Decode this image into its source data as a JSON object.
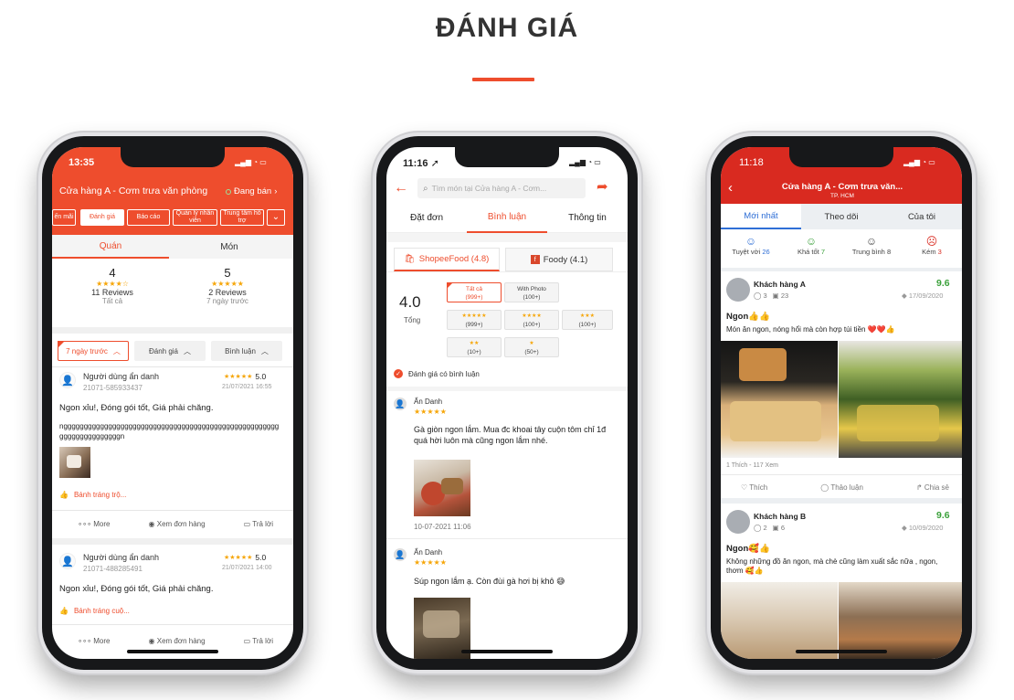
{
  "title": "ĐÁNH GIÁ",
  "colors": {
    "accent": "#ee4d2d",
    "star": "#f6a609",
    "green": "#3aa03a",
    "blue": "#2f6fd6"
  },
  "phone1": {
    "time": "13:35",
    "shop_name": "Cửa hàng A - Cơm trưa văn phòng",
    "status": "Đang bán",
    "chips": [
      "ến mãi",
      "Đánh giá",
      "Báo cáo",
      "Quản lý nhân viên",
      "Trung tâm hỗ trợ"
    ],
    "tabs": [
      "Quán",
      "Món"
    ],
    "summary": [
      {
        "score": "4",
        "reviews": "11 Reviews",
        "caption": "Tất cả"
      },
      {
        "score": "5",
        "reviews": "2 Reviews",
        "caption": "7 ngày trước"
      }
    ],
    "filters": [
      "7 ngày trước",
      "Đánh giá",
      "Bình luận"
    ],
    "reviews": [
      {
        "user": "Người dùng ẩn danh",
        "order_id": "21071-585933437",
        "score": "5.0",
        "date": "21/07/2021 16:55",
        "text": "Ngon xỉu!, Đóng gói tốt, Giá phải chăng.",
        "extra": "nggggggggggggggggggggggggggggggggggggggggggggggggggggggggggggggggggggn",
        "tag": "Bánh tráng trộ..."
      },
      {
        "user": "Người dùng ẩn danh",
        "order_id": "21071-488285491",
        "score": "5.0",
        "date": "21/07/2021 14:00",
        "text": "Ngon xỉu!, Đóng gói tốt, Giá phải chăng.",
        "tag": "Bánh tráng cuộ..."
      }
    ],
    "actions": [
      "More",
      "Xem đơn hàng",
      "Trả lời"
    ]
  },
  "phone2": {
    "time": "11:16",
    "search_placeholder": "Tìm món tại Cửa hàng A - Cơm...",
    "tabs": [
      "Đặt đơn",
      "Bình luận",
      "Thông tin"
    ],
    "sources": [
      "ShopeeFood (4.8)",
      "Foody (4.1)"
    ],
    "overall": "4.0",
    "overall_label": "Tổng",
    "rating_filters": [
      {
        "label": "Tất cả",
        "count": "(999+)"
      },
      {
        "label": "With Photo",
        "count": "(100+)"
      },
      {
        "label": "★★★★★",
        "count": "(999+)"
      },
      {
        "label": "★★★★",
        "count": "(100+)"
      },
      {
        "label": "★★★",
        "count": "(100+)"
      },
      {
        "label": "★★",
        "count": "(10+)"
      },
      {
        "label": "★",
        "count": "(50+)"
      }
    ],
    "has_comment_label": "Đánh giá có bình luận",
    "reviews": [
      {
        "user": "Ẩn Danh",
        "text": "Gà giòn ngon lắm. Mua đc khoai tây cuộn tôm chỉ 1đ quá hời luôn mà cũng ngon lắm nhé.",
        "date": "10-07-2021 11:06"
      },
      {
        "user": "Ẩn Danh",
        "text": "Súp ngon lắm ạ. Còn đùi gà hơi bị khô 😅"
      }
    ]
  },
  "phone3": {
    "time": "11:18",
    "shop_name": "Cửa hàng A - Cơm trưa văn...",
    "city": "TP. HCM",
    "tabs": [
      "Mới nhất",
      "Theo dõi",
      "Của tôi"
    ],
    "moods": [
      {
        "label": "Tuyệt vời",
        "count": "26"
      },
      {
        "label": "Khá tốt",
        "count": "7"
      },
      {
        "label": "Trung bình",
        "count": "8"
      },
      {
        "label": "Kém",
        "count": "3"
      }
    ],
    "posts": [
      {
        "user": "Khách hàng A",
        "comments": "3",
        "photos": "23",
        "score": "9.6",
        "date": "17/09/2020",
        "title": "Ngon👍👍",
        "text": "Món ăn ngon, nóng hổi mà còn hợp túi tiền ❤️❤️👍",
        "stats": "1 Thích - 117 Xem"
      },
      {
        "user": "Khách hàng B",
        "comments": "2",
        "photos": "6",
        "score": "9.6",
        "date": "10/09/2020",
        "title": "Ngon🥰👍",
        "text": "Không những đồ ăn ngon, mà chè cũng làm xuất sắc nữa , ngon, thơm 🥰👍"
      }
    ],
    "actions": [
      "Thích",
      "Thảo luận",
      "Chia sẻ"
    ]
  }
}
